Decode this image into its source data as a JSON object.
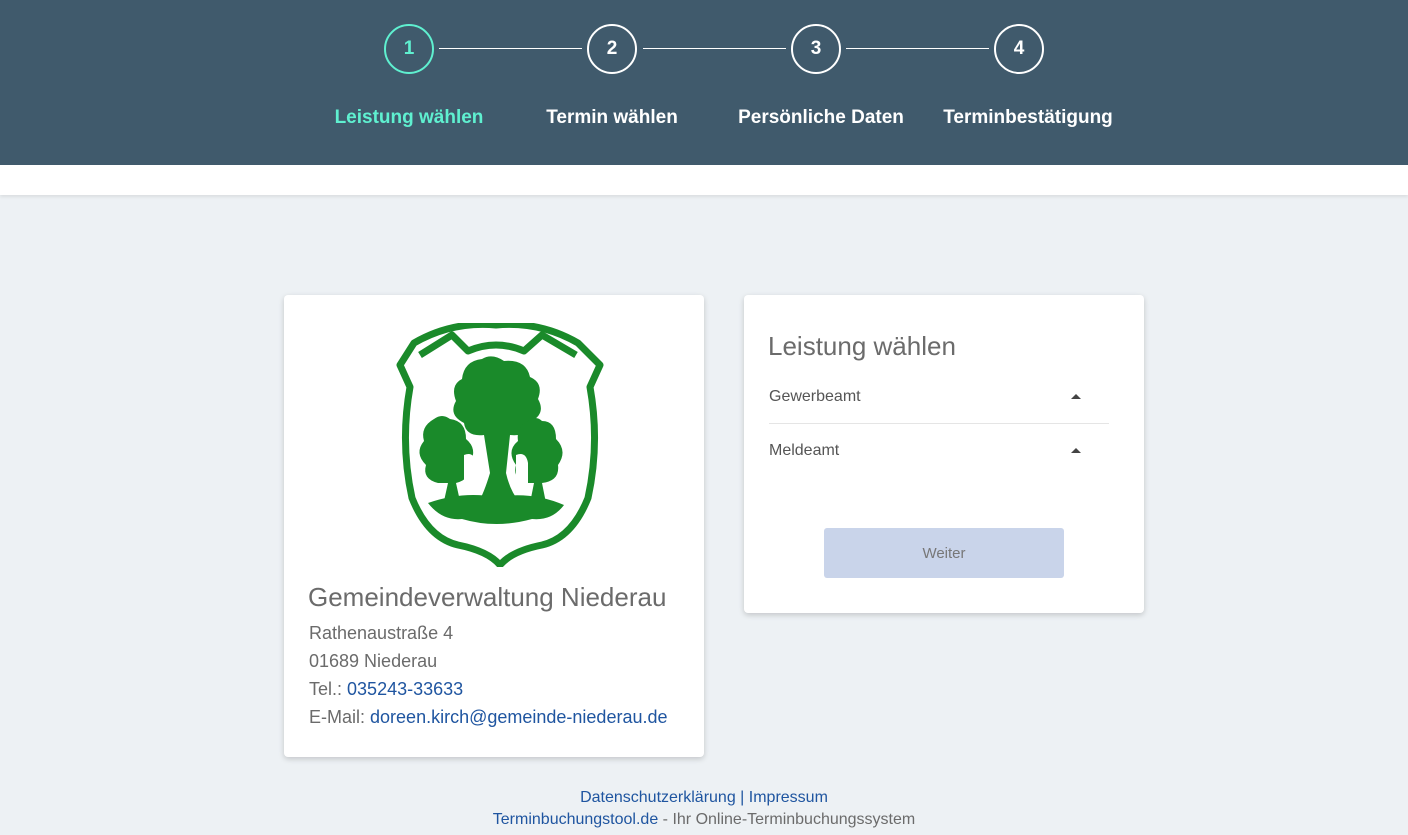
{
  "stepper": {
    "steps": [
      {
        "number": "1",
        "label": "Leistung wählen",
        "active": true
      },
      {
        "number": "2",
        "label": "Termin wählen",
        "active": false
      },
      {
        "number": "3",
        "label": "Persönliche Daten",
        "active": false
      },
      {
        "number": "4",
        "label": "Terminbestätigung",
        "active": false
      }
    ],
    "active_color": "#5ff0d0",
    "background_color": "#405a6c"
  },
  "info_card": {
    "logo_icon": "municipality-crest-trees-icon",
    "logo_color": "#1a8a2a",
    "org_name": "Gemeindeverwaltung Niederau",
    "street": "Rathenaustraße 4",
    "city": "01689 Niederau",
    "phone_label": "Tel.:",
    "phone": "035243-33633",
    "email_label": "E-Mail:",
    "email": "doreen.kirch@gemeinde-niederau.de"
  },
  "service_card": {
    "title": "Leistung wählen",
    "departments": [
      {
        "label": "Gewerbeamt",
        "icon": "caret-up-icon"
      },
      {
        "label": "Meldeamt",
        "icon": "caret-up-icon"
      }
    ],
    "next_button": "Weiter"
  },
  "footer": {
    "privacy": "Datenschutzerklärung",
    "separator": "|",
    "imprint": "Impressum",
    "tool_link": "Terminbuchungstool.de",
    "tool_suffix": "- Ihr Online-Terminbuchungssystem"
  }
}
